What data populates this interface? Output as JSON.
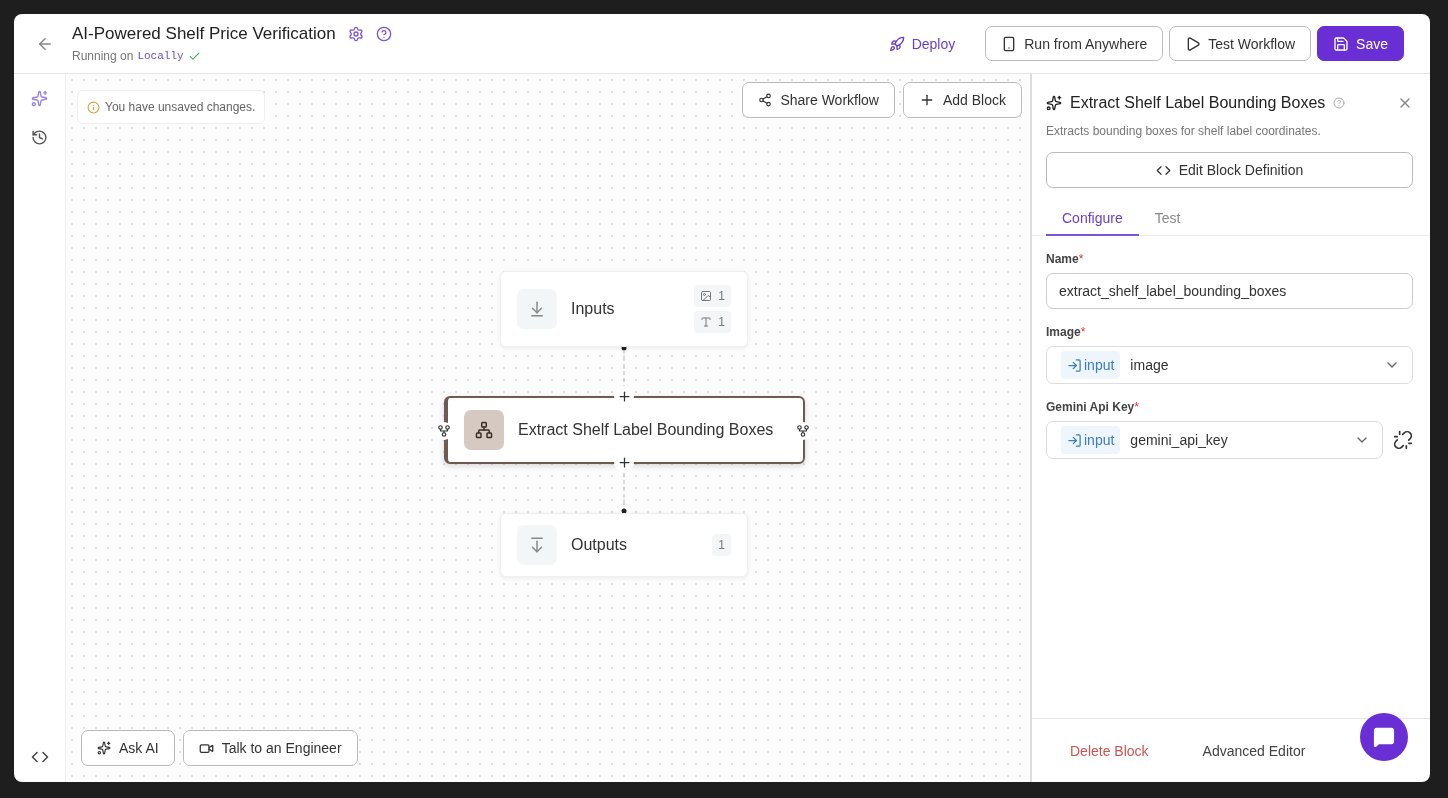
{
  "header": {
    "title": "AI-Powered Shelf Price Verification",
    "status_prefix": "Running on",
    "environment": "Locally",
    "verified": true
  },
  "header_actions": [
    {
      "kind": "link",
      "label": "Deploy"
    },
    {
      "kind": "outline",
      "label": "Run from Anywhere"
    },
    {
      "kind": "outline",
      "label": "Test Workflow"
    },
    {
      "kind": "primary",
      "label": "Save"
    }
  ],
  "sidebar": {
    "items": [
      {
        "selected": true
      },
      {
        "selected": false
      }
    ]
  },
  "canvas": {
    "notice": "You have unsaved changes.",
    "toolbar": [
      "Share Workflow",
      "Add Block"
    ],
    "nodes": [
      {
        "kind": "inputs",
        "label": "Inputs",
        "selected": false,
        "badges": [
          "1",
          "1"
        ]
      },
      {
        "kind": "block",
        "label": "Extract Shelf Label Bounding Boxes",
        "selected": true
      },
      {
        "kind": "outputs",
        "label": "Outputs",
        "selected": false,
        "badges": [
          "1"
        ]
      }
    ],
    "bottom_actions": [
      "Ask AI",
      "Talk to an Engineer"
    ]
  },
  "panel": {
    "title": "Extract Shelf Label Bounding Boxes",
    "description": "Extracts bounding boxes for shelf label coordinates.",
    "edit_button": "Edit Block Definition",
    "tabs": [
      {
        "label": "Configure",
        "selected": true
      },
      {
        "label": "Test",
        "selected": false
      }
    ],
    "fields": [
      {
        "kind": "text",
        "label": "Name",
        "required_mark": "*",
        "value": "extract_shelf_label_bounding_boxes"
      },
      {
        "kind": "select",
        "label": "Image",
        "required_mark": "*",
        "tag": "input",
        "value": "image"
      },
      {
        "kind": "select_unlink",
        "label": "Gemini Api Key",
        "required_mark": "*",
        "tag": "input",
        "value": "gemini_api_key"
      }
    ],
    "footer": [
      {
        "kind": "danger",
        "label": "Delete Block"
      },
      {
        "kind": "plain",
        "label": "Advanced Editor"
      }
    ]
  }
}
